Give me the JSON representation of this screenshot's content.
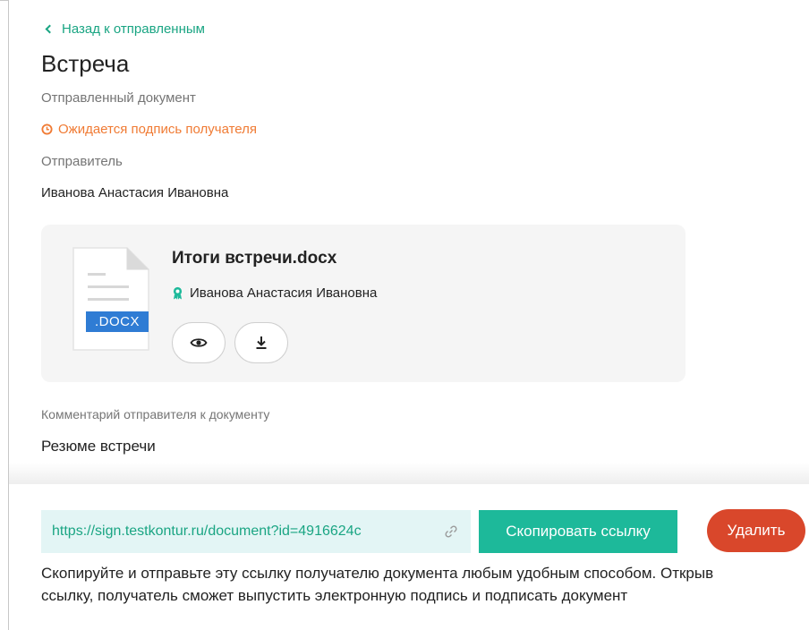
{
  "header": {
    "back_link": "Назад к отправленным",
    "title": "Встреча",
    "subtitle": "Отправленный документ",
    "status": "Ожидается подпись получателя",
    "sender_label": "Отправитель",
    "sender_name": "Иванова Анастасия Ивановна"
  },
  "document": {
    "file_name": "Итоги встречи.docx",
    "extension_badge": ".DOCX",
    "signer": "Иванова Анастасия Ивановна",
    "view_icon": "eye-icon",
    "download_icon": "download-icon"
  },
  "comment": {
    "label": "Комментарий отправителя к документу",
    "text": "Резюме встречи"
  },
  "share": {
    "link": "https://sign.testkontur.ru/document?id=4916624c",
    "copy_label": "Скопировать ссылку",
    "delete_label": "Удалить",
    "help": "Скопируйте и отправьте эту ссылку получателю документа любым удобным способом. Открыв ссылку, получатель сможет выпустить электронную подпись и подписать документ"
  },
  "colors": {
    "accent": "#1aa583",
    "warning": "#f07b34",
    "copy_button": "#1db99a",
    "delete_button": "#d9472b",
    "link_background": "#e3f5f5",
    "docx_badge": "#2f7cd4"
  }
}
